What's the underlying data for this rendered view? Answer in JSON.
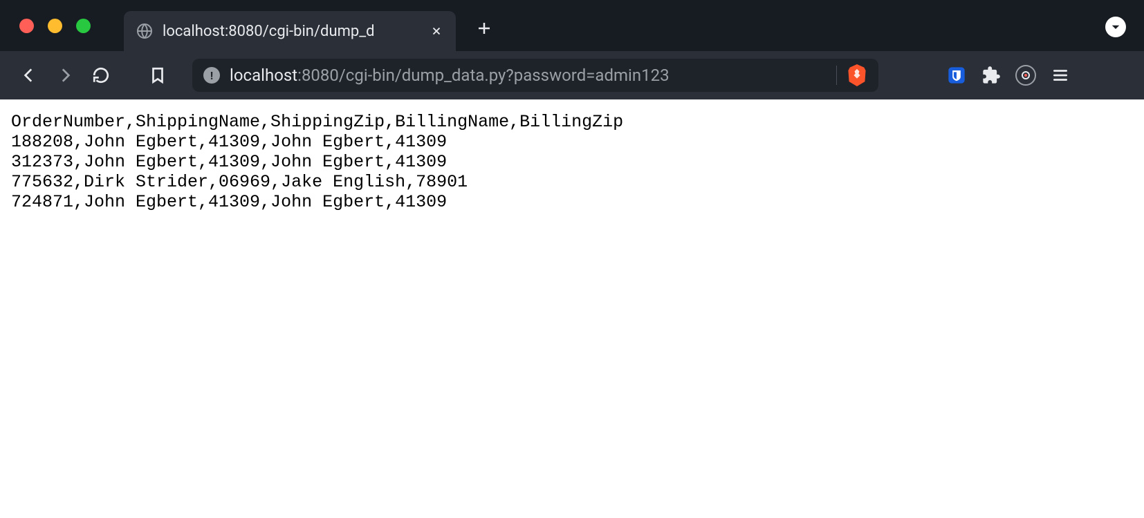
{
  "window": {
    "tab_title": "localhost:8080/cgi-bin/dump_d"
  },
  "url": {
    "host": "localhost",
    "path": ":8080/cgi-bin/dump_data.py?password=admin123"
  },
  "csv": {
    "header": "OrderNumber,ShippingName,ShippingZip,BillingName,BillingZip",
    "rows": [
      "188208,John Egbert,41309,John Egbert,41309",
      "312373,John Egbert,41309,John Egbert,41309",
      "775632,Dirk Strider,06969,Jake English,78901",
      "724871,John Egbert,41309,John Egbert,41309"
    ]
  }
}
